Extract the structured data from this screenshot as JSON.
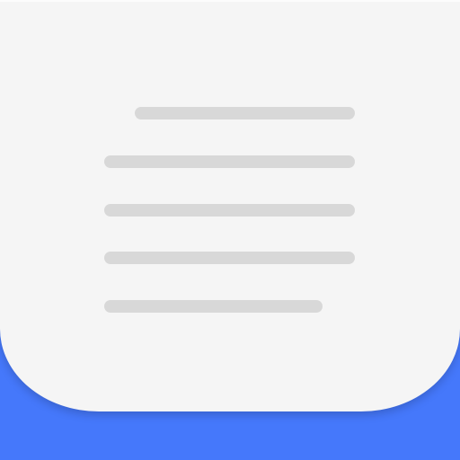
{
  "icon": {
    "name": "notes-app-icon",
    "sheet_color": "#f5f5f5",
    "base_color": "#4578fb",
    "line_color": "#d8d8d8",
    "text_line_count": 5
  }
}
